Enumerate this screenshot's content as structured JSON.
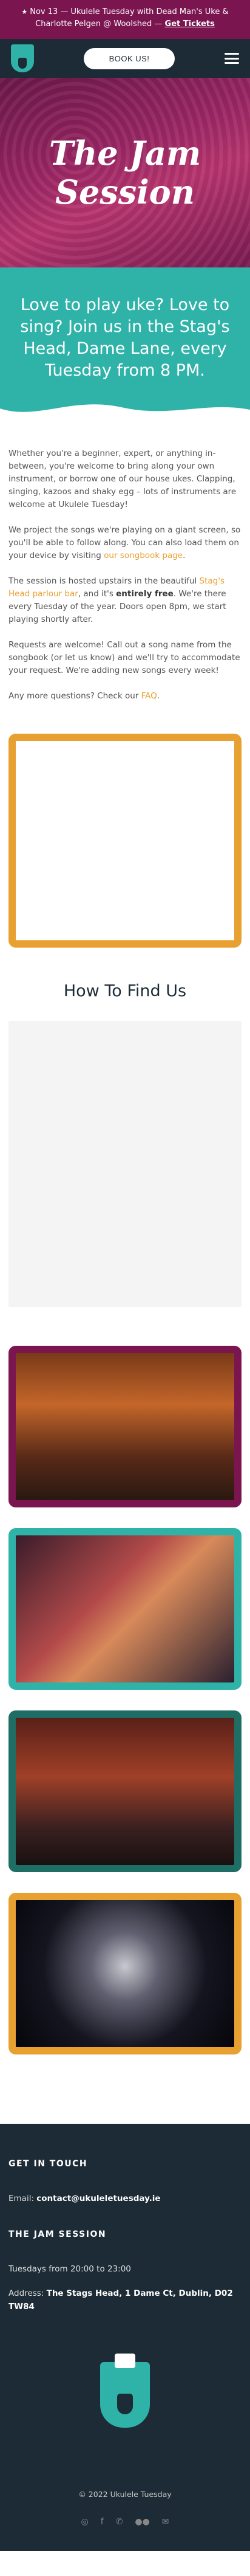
{
  "announcement": {
    "icon": "★",
    "text": "Nov 13 — Ukulele Tuesday with Dead Man's Uke & Charlotte Pelgen @ Woolshed — ",
    "link": "Get Tickets"
  },
  "nav": {
    "book_label": "BOOK US!"
  },
  "hero": {
    "title": "The Jam Session"
  },
  "intro": {
    "heading": "Love to play uke? Love to sing? Join us in the Stag's Head, Dame Lane, every Tuesday from 8 PM."
  },
  "body": {
    "p1": "Whether you're a beginner, expert, or anything in-between, you're welcome to bring along your own instrument, or borrow one of our house ukes. Clapping, singing, kazoos and shaky egg – lots of instruments are welcome at Ukulele Tuesday!",
    "p2_a": "We project the songs we're playing on a giant screen, so you'll be able to follow along. You can also load them on your device by visiting ",
    "p2_link": "our songbook page",
    "p2_b": ".",
    "p3_a": "The session is hosted upstairs in the beautiful ",
    "p3_link": "Stag's Head parlour bar",
    "p3_b": ", and it's ",
    "p3_bold": "entirely free",
    "p3_c": ". We're there every Tuesday of the year. Doors open 8pm, we start playing shortly after.",
    "p4": "Requests are welcome! Call out a song name from the songbook (or let us know) and we'll try to accommodate your request. We're adding new songs every week!",
    "p5_a": "Any more questions? Check our ",
    "p5_link": "FAQ",
    "p5_b": "."
  },
  "find": {
    "heading": "How To Find Us"
  },
  "footer": {
    "contact_heading": "GET IN TOUCH",
    "email_label": "Email: ",
    "email": "contact@ukuleletuesday.ie",
    "session_heading": "THE JAM SESSION",
    "hours": "Tuesdays from 20:00 to 23:00",
    "address_label": "Address: ",
    "address": "The Stags Head, 1 Dame Ct, Dublin, D02 TW84",
    "copyright": "© 2022 Ukulele Tuesday",
    "socials": [
      "instagram-icon",
      "facebook-icon",
      "whatsapp-icon",
      "flickr-icon",
      "email-icon"
    ]
  },
  "colors": {
    "magenta": "#7a1550",
    "teal": "#2fb3a9",
    "orange": "#e8a030",
    "navy": "#1c2b35",
    "dark-teal": "#1f6e66"
  }
}
